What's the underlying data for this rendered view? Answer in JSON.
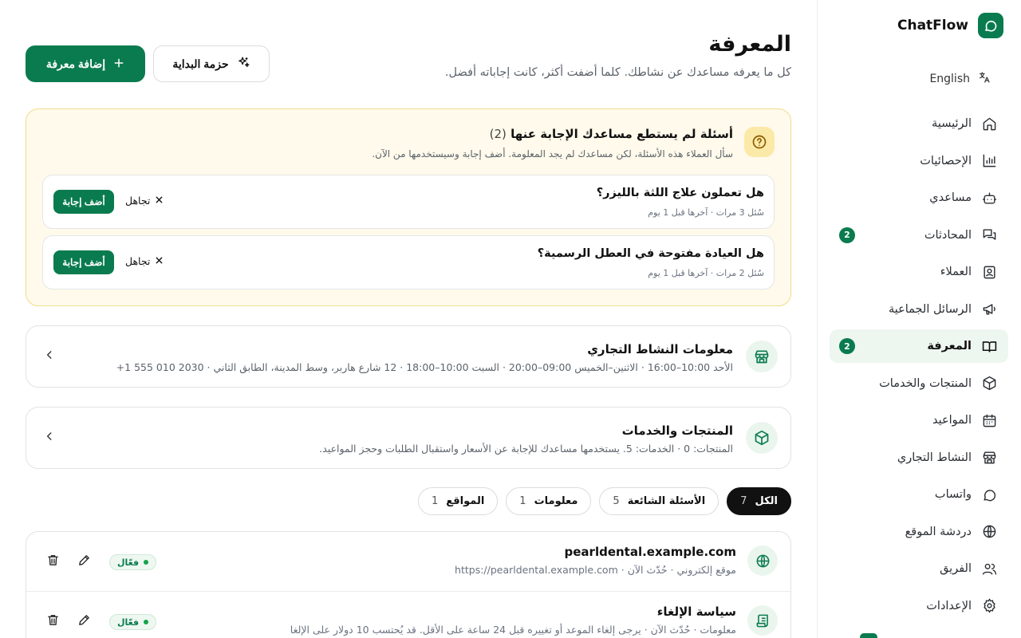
{
  "sidebar": {
    "brand": "ChatFlow",
    "language": "English",
    "items": [
      {
        "label": "الرئيسية",
        "icon": "home-icon",
        "badge": ""
      },
      {
        "label": "الإحصائيات",
        "icon": "chart-icon",
        "badge": ""
      },
      {
        "label": "مساعدي",
        "icon": "bot-icon",
        "badge": ""
      },
      {
        "label": "المحادثات",
        "icon": "chat-icon",
        "badge": "2"
      },
      {
        "label": "العملاء",
        "icon": "contact-icon",
        "badge": ""
      },
      {
        "label": "الرسائل الجماعية",
        "icon": "megaphone-icon",
        "badge": ""
      },
      {
        "label": "المعرفة",
        "icon": "book-icon",
        "badge": "2"
      },
      {
        "label": "المنتجات والخدمات",
        "icon": "package-icon",
        "badge": ""
      },
      {
        "label": "المواعيد",
        "icon": "calendar-icon",
        "badge": ""
      },
      {
        "label": "النشاط التجاري",
        "icon": "store-icon",
        "badge": ""
      },
      {
        "label": "واتساب",
        "icon": "whatsapp-icon",
        "badge": ""
      },
      {
        "label": "دردشة الموقع",
        "icon": "globe-icon",
        "badge": ""
      },
      {
        "label": "الفريق",
        "icon": "team-icon",
        "badge": ""
      },
      {
        "label": "الإعدادات",
        "icon": "settings-icon",
        "badge": ""
      }
    ]
  },
  "header": {
    "title": "المعرفة",
    "subtitle": "كل ما يعرفه مساعدك عن نشاطك. كلما أضفت أكثر، كانت إجاباته أفضل.",
    "add_button": "إضافة معرفة",
    "starter_button": "حزمة البداية"
  },
  "unanswered": {
    "title": "أسئلة لم يستطع مساعدك الإجابة عنها",
    "count": "(2)",
    "description": "سأل العملاء هذه الأسئلة، لكن مساعدك لم يجد المعلومة. أضف إجابة وسيستخدمها من الآن.",
    "ignore_label": "تجاهل",
    "answer_label": "أضف إجابة",
    "questions": [
      {
        "text": "هل تعملون علاج اللثة بالليزر؟",
        "meta": "سُئل 3 مرات · آخرها قبل 1 يوم"
      },
      {
        "text": "هل العيادة مفتوحة في العطل الرسمية؟",
        "meta": "سُئل 2 مرات · آخرها قبل 1 يوم"
      }
    ]
  },
  "business_info": {
    "title": "معلومات النشاط التجاري",
    "description": "الأحد 10:00–16:00 · الاثنين–الخميس 09:00–20:00 · السبت 10:00–18:00 · 12 شارع هاربر، وسط المدينة، الطابق الثاني · ‎+1 555 010 2030"
  },
  "products_info": {
    "title": "المنتجات والخدمات",
    "description": "المنتجات: 0 · الخدمات: 5. يستخدمها مساعدك للإجابة عن الأسعار واستقبال الطلبات وحجز المواعيد."
  },
  "filters": [
    {
      "label": "الكل",
      "count": "7",
      "active": true
    },
    {
      "label": "الأسئلة الشائعة",
      "count": "5",
      "active": false
    },
    {
      "label": "معلومات",
      "count": "1",
      "active": false
    },
    {
      "label": "المواقع",
      "count": "1",
      "active": false
    }
  ],
  "entries": [
    {
      "title": "pearldental.example.com",
      "type": "موقع إلكتروني",
      "updated": "حُدّث الآن",
      "detail": "https://pearldental.example.com",
      "status": "فعّال",
      "icon": "globe-icon"
    },
    {
      "title": "سياسة الإلغاء",
      "type": "معلومات",
      "updated": "حُدّث الآن",
      "detail": "يرجى إلغاء الموعد أو تغييره قبل 24 ساعة على الأقل. قد يُحتسب 10 دولار على الإلغا",
      "status": "فعّال",
      "icon": "document-icon"
    }
  ],
  "colors": {
    "accent": "#0a7b4f",
    "warning_bg": "#fffaeb",
    "warning_border": "#f0dc8a"
  }
}
